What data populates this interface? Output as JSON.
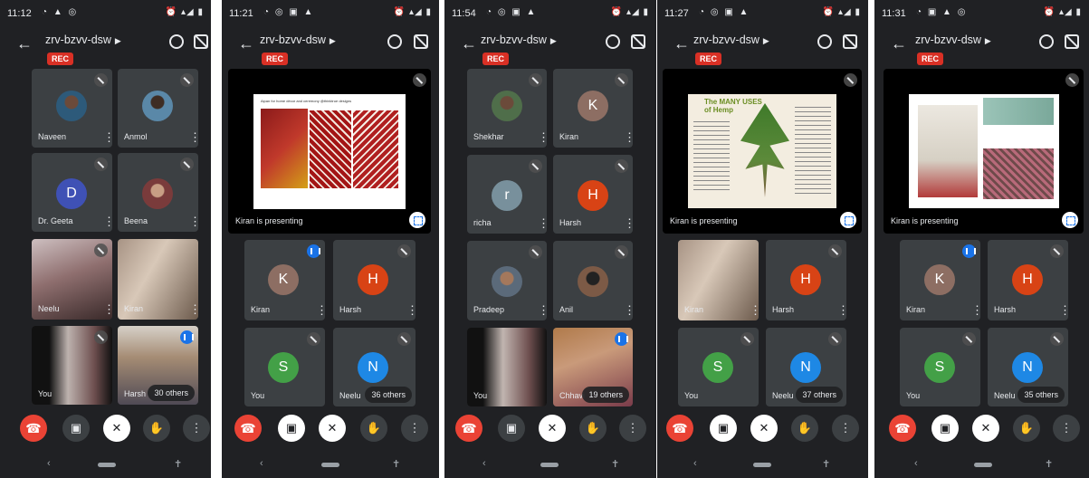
{
  "screens": [
    {
      "time": "11:12",
      "meeting_code": "zrv-bzvv-dsw",
      "rec_label": "REC",
      "tiles": [
        "Naveen",
        "Anmol",
        "Dr. Geeta",
        "Beena",
        "Neelu",
        "Kiran",
        "You",
        "Harsh"
      ],
      "avatar_letters": {
        "Dr. Geeta": "D"
      },
      "others_label": "30 others"
    },
    {
      "time": "11:21",
      "meeting_code": "zrv-bzvv-dsw",
      "rec_label": "REC",
      "presenting_label": "Kiran is presenting",
      "slide_title": "Aipan for home décor and ceremony @thinktrue designs",
      "tiles": [
        "Kiran",
        "Harsh",
        "You",
        "Neelu"
      ],
      "avatar_letters": {
        "Kiran": "K",
        "Harsh": "H",
        "You": "S",
        "Neelu": "N"
      },
      "others_label": "36 others"
    },
    {
      "time": "11:54",
      "meeting_code": "zrv-bzvv-dsw",
      "rec_label": "REC",
      "tiles": [
        "Shekhar",
        "Kiran",
        "richa",
        "Harsh",
        "Pradeep",
        "Anil",
        "You",
        "Chhavi"
      ],
      "avatar_letters": {
        "Kiran": "K",
        "richa": "r",
        "Harsh": "H"
      },
      "others_label": "19 others"
    },
    {
      "time": "11:27",
      "meeting_code": "zrv-bzvv-dsw",
      "rec_label": "REC",
      "presenting_label": "Kiran is presenting",
      "slide_title": "The MANY USES of Hemp",
      "tiles": [
        "Kiran",
        "Harsh",
        "You",
        "Neelu"
      ],
      "avatar_letters": {
        "Harsh": "H",
        "You": "S",
        "Neelu": "N"
      },
      "others_label": "37 others"
    },
    {
      "time": "11:31",
      "meeting_code": "zrv-bzvv-dsw",
      "rec_label": "REC",
      "presenting_label": "Kiran is presenting",
      "slide_title": "",
      "tiles": [
        "Kiran",
        "Harsh",
        "You",
        "Neelu"
      ],
      "avatar_letters": {
        "Kiran": "K",
        "Harsh": "H",
        "You": "S",
        "Neelu": "N"
      },
      "others_label": "35 others"
    }
  ],
  "colors": {
    "background": "#202124",
    "tile": "#3c4043",
    "end_call": "#ea4335",
    "rec": "#d93025",
    "avatar_D": "#3f51b5",
    "avatar_K": "#8d6e63",
    "avatar_H": "#d84315",
    "avatar_S": "#43a047",
    "avatar_N": "#1e88e5",
    "avatar_r": "#78909c"
  },
  "icons": {
    "back": "arrow-left-icon",
    "switch_camera": "switch-camera-icon",
    "speaker_off": "speaker-off-icon",
    "end_call": "end-call-icon",
    "camera": "camera-icon",
    "mic_off": "mic-off-icon",
    "raise_hand": "hand-icon",
    "more": "more-vert-icon"
  }
}
